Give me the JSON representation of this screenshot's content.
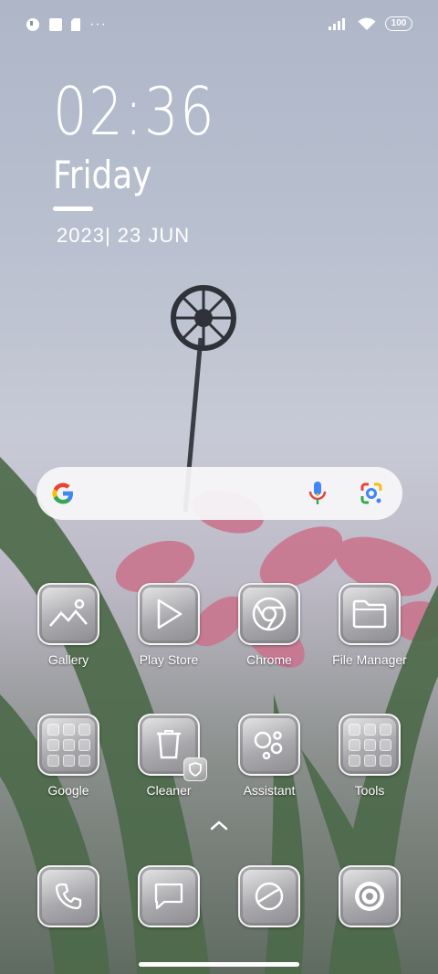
{
  "status_bar": {
    "left_icons": [
      "app-notification-icon",
      "square-notification-icon",
      "sim-notification-icon"
    ],
    "more": "···",
    "battery": "100"
  },
  "clock": {
    "time": "02:36",
    "day": "Friday",
    "date": "2023| 23 JUN"
  },
  "search": {
    "icons": [
      "google-g-icon",
      "microphone-icon",
      "google-lens-icon"
    ]
  },
  "apps_row1": [
    {
      "label": "Gallery",
      "icon": "gallery-icon"
    },
    {
      "label": "Play Store",
      "icon": "play-store-icon"
    },
    {
      "label": "Chrome",
      "icon": "chrome-icon"
    },
    {
      "label": "File Manager",
      "icon": "folder-icon"
    }
  ],
  "apps_row2": [
    {
      "label": "Google",
      "icon": "google-folder-icon"
    },
    {
      "label": "Cleaner",
      "icon": "trash-icon"
    },
    {
      "label": "Assistant",
      "icon": "assistant-icon"
    },
    {
      "label": "Tools",
      "icon": "tools-folder-icon"
    }
  ],
  "dock": [
    {
      "icon": "phone-icon"
    },
    {
      "icon": "messages-icon"
    },
    {
      "icon": "browser-icon"
    },
    {
      "icon": "camera-icon"
    }
  ],
  "colors": {
    "text": "#ffffff",
    "search_bg": "#f8f8fa",
    "google_blue": "#4285F4",
    "google_red": "#EA4335",
    "google_yellow": "#FBBC05",
    "google_green": "#34A853"
  }
}
